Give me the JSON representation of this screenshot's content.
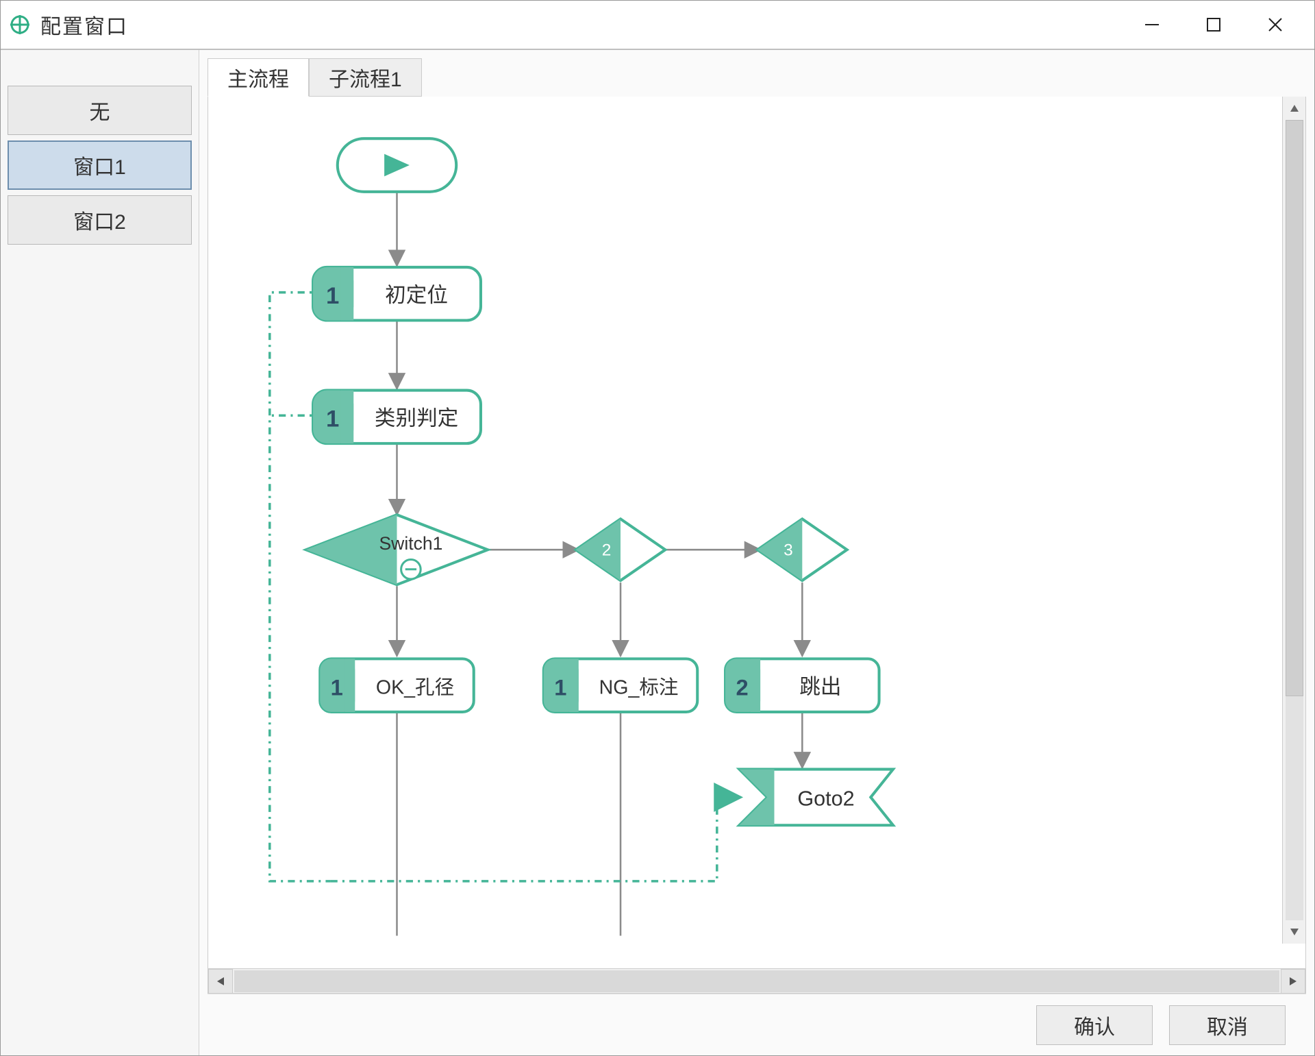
{
  "window": {
    "title": "配置窗口"
  },
  "sidebar": {
    "items": [
      {
        "label": "无",
        "selected": false
      },
      {
        "label": "窗口1",
        "selected": true
      },
      {
        "label": "窗口2",
        "selected": false
      }
    ]
  },
  "tabs": [
    {
      "label": "主流程",
      "active": true
    },
    {
      "label": "子流程1",
      "active": false
    }
  ],
  "flow": {
    "nodes": {
      "start": {
        "type": "start"
      },
      "n1": {
        "badge": "1",
        "label": "初定位"
      },
      "n2": {
        "badge": "1",
        "label": "类别判定"
      },
      "switch1": {
        "label": "Switch1",
        "icon": "minus"
      },
      "d2": {
        "label": "2"
      },
      "d3": {
        "label": "3"
      },
      "ok": {
        "badge": "1",
        "label": "OK_孔径"
      },
      "ng": {
        "badge": "1",
        "label": "NG_标注"
      },
      "jump": {
        "badge": "2",
        "label": "跳出"
      },
      "goto2": {
        "label": "Goto2"
      }
    }
  },
  "footer": {
    "confirm": "确认",
    "cancel": "取消"
  },
  "colors": {
    "teal": "#45b597",
    "tealFill": "#6ec3ab",
    "tealLight": "#d8efe8",
    "gray": "#8b8b8b"
  }
}
